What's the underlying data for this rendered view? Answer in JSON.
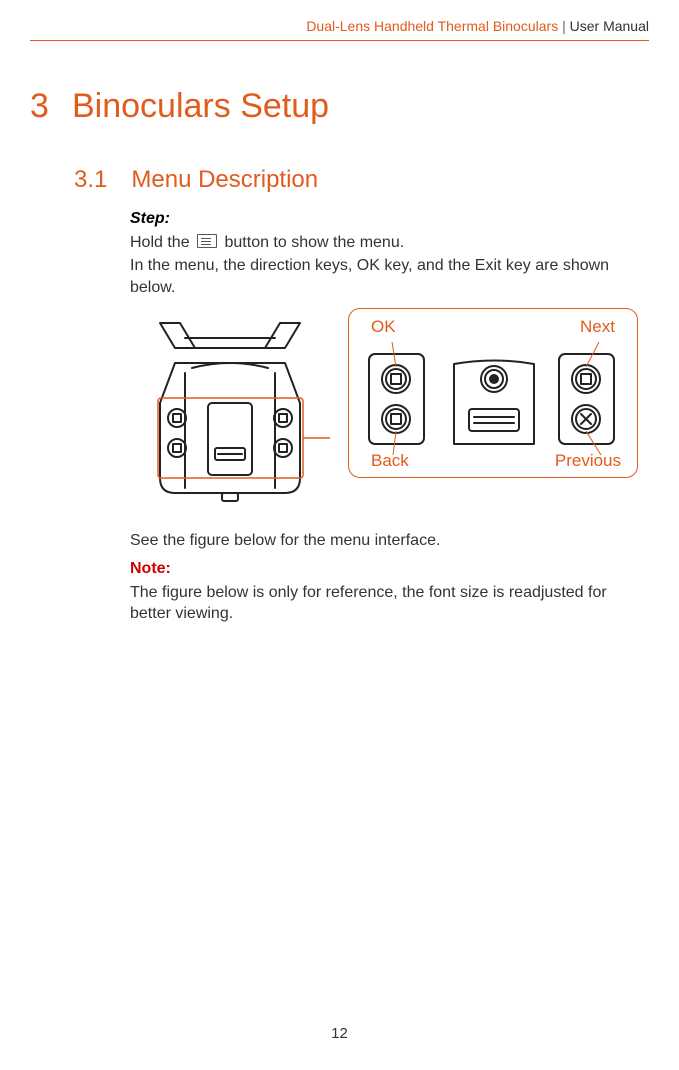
{
  "header": {
    "product": "Dual-Lens Handheld Thermal Binoculars",
    "separator": " | ",
    "doc": "User Manual"
  },
  "chapter": {
    "number": "3",
    "title": "Binoculars Setup"
  },
  "section": {
    "number": "3.1",
    "title": "Menu Description"
  },
  "body": {
    "step_label": "Step:",
    "hold_pre": "Hold the ",
    "hold_post": " button to show the menu.",
    "keys_description": "In the menu, the direction keys, OK key, and the Exit key are shown below.",
    "see_figure": "See the figure below for the menu interface.",
    "note_label": "Note:",
    "note_text": "The figure below is only for reference, the font size is readjusted for better viewing."
  },
  "callouts": {
    "ok": "OK",
    "next": "Next",
    "back": "Back",
    "previous": "Previous"
  },
  "page_number": "12"
}
